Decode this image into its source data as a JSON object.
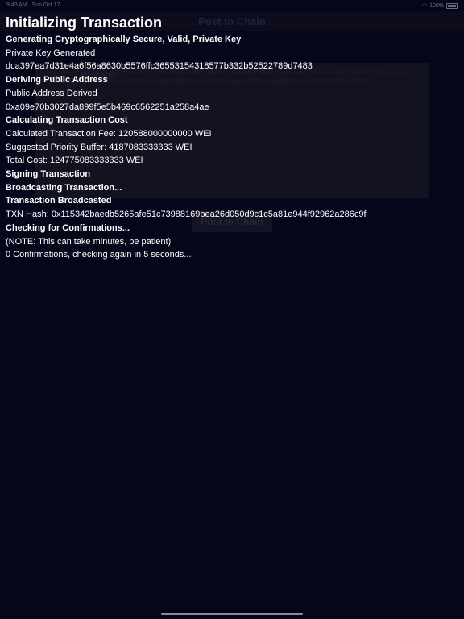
{
  "status_bar": {
    "time": "9:43 AM",
    "date": "Sun Oct 17",
    "battery": "100%"
  },
  "background": {
    "nav_title": "Post to Chain",
    "message_label": "Message:",
    "message_text": "It is hereby placed on the chain record that entity A and that they have decided to take note of this matter should consequence arise in the future. Let the record show that entity A was indeed aware of the copyright issues at this date and time.",
    "post_button": "Post to Chain"
  },
  "log": {
    "title": "Initializing Transaction",
    "lines": [
      {
        "text": "Generating Cryptographically Secure, Valid, Private Key",
        "bold": true
      },
      {
        "text": "Private Key Generated",
        "bold": false
      },
      {
        "text": "dca397ea7d31e4a6f56a8630b5576ffc36553154318577b332b52522789d7483",
        "bold": false
      },
      {
        "text": "Deriving Public Address",
        "bold": true
      },
      {
        "text": "Public Address Derived",
        "bold": false
      },
      {
        "text": "0xa09e70b3027da899f5e5b469c6562251a258a4ae",
        "bold": false
      },
      {
        "text": "Calculating Transaction Cost",
        "bold": true
      },
      {
        "text": "Calculated Transaction Fee: 120588000000000 WEI",
        "bold": false
      },
      {
        "text": "Suggested Priority Buffer: 4187083333333 WEI",
        "bold": false
      },
      {
        "text": "Total Cost: 124775083333333 WEI",
        "bold": false
      },
      {
        "text": "Signing Transaction",
        "bold": true
      },
      {
        "text": "Broadcasting Transaction...",
        "bold": true
      },
      {
        "text": "Transaction Broadcasted",
        "bold": true
      },
      {
        "text": "TXN Hash: 0x115342baedb5265afe51c73988169bea26d050d9c1c5a81e944f92962a286c9f",
        "bold": false
      },
      {
        "text": "Checking for Confirmations...",
        "bold": true
      },
      {
        "text": "(NOTE: This can take minutes, be patient)",
        "bold": false
      },
      {
        "text": "0 Confirmations, checking again in 5 seconds...",
        "bold": false
      }
    ]
  }
}
